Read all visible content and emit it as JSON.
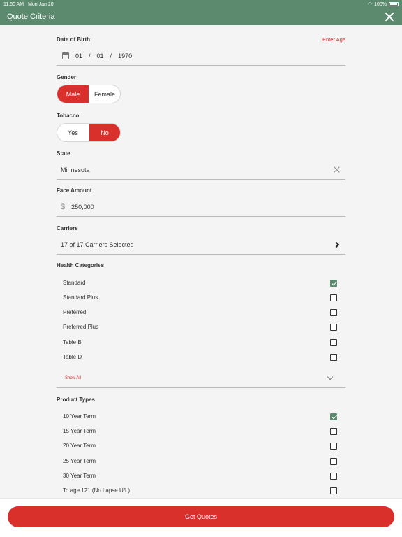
{
  "status_bar": {
    "time": "11:50 AM",
    "date": "Mon Jan 20",
    "battery": "100%"
  },
  "nav": {
    "title": "Quote Criteria"
  },
  "dob": {
    "label": "Date of Birth",
    "enter_age": "Enter Age",
    "month": "01",
    "day": "01",
    "year": "1970",
    "sep": "/"
  },
  "gender": {
    "label": "Gender",
    "options": [
      "Male",
      "Female"
    ],
    "selected": "Male"
  },
  "tobacco": {
    "label": "Tobacco",
    "options": [
      "Yes",
      "No"
    ],
    "selected": "No"
  },
  "state": {
    "label": "State",
    "value": "Minnesota"
  },
  "face_amount": {
    "label": "Face Amount",
    "currency": "$",
    "value": "250,000"
  },
  "carriers": {
    "label": "Carriers",
    "value": "17 of 17 Carriers Selected"
  },
  "health_categories": {
    "label": "Health Categories",
    "items": [
      {
        "label": "Standard",
        "checked": true
      },
      {
        "label": "Standard Plus",
        "checked": false
      },
      {
        "label": "Preferred",
        "checked": false
      },
      {
        "label": "Preferred Plus",
        "checked": false
      },
      {
        "label": "Table B",
        "checked": false
      },
      {
        "label": "Table D",
        "checked": false
      }
    ],
    "show_all": "Show All"
  },
  "product_types": {
    "label": "Product Types",
    "items": [
      {
        "label": "10 Year Term",
        "checked": true
      },
      {
        "label": "15 Year Term",
        "checked": false
      },
      {
        "label": "20 Year Term",
        "checked": false
      },
      {
        "label": "25 Year Term",
        "checked": false
      },
      {
        "label": "30 Year Term",
        "checked": false
      },
      {
        "label": "To age 121 (No Lapse U/L)",
        "checked": false
      }
    ]
  },
  "footer": {
    "get_quotes": "Get Quotes"
  },
  "colors": {
    "header": "#5b8a6e",
    "accent": "#d9302c"
  }
}
